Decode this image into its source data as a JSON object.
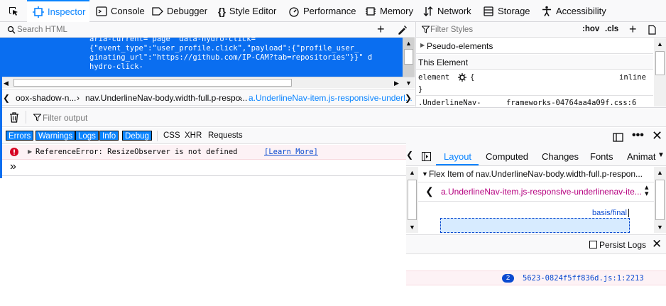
{
  "toolbar": {
    "tabs": [
      {
        "label": "Inspector",
        "icon": "inspector-icon"
      },
      {
        "label": "Console",
        "icon": "console-icon"
      },
      {
        "label": "Debugger",
        "icon": "debugger-icon"
      },
      {
        "label": "Style Editor",
        "icon": "style-editor-icon"
      },
      {
        "label": "Performance",
        "icon": "performance-icon"
      },
      {
        "label": "Memory",
        "icon": "memory-icon"
      },
      {
        "label": "Network",
        "icon": "network-icon"
      },
      {
        "label": "Storage",
        "icon": "storage-icon"
      },
      {
        "label": "Accessibility",
        "icon": "accessibility-icon"
      }
    ],
    "active_tab": "Inspector"
  },
  "inspector": {
    "search_placeholder": "Search HTML",
    "markup_lines": [
      "aria-current=\"page\" data-hydro-click=",
      "{\"event_type\":\"user_profile.click\",\"payload\":{\"profile_user_",
      "ginating_url\":\"https://github.com/IP-CAM?tab=repositories\"}}\" d",
      "hydro-click-",
      "                                                                 "
    ],
    "breadcrumbs": [
      "oox-shadow-n...",
      "nav.UnderlineNav-body.width-full.p-respo...",
      "a.UnderlineNav-item.js-responsive-underl..."
    ]
  },
  "rules": {
    "filter_placeholder": "Filter Styles",
    "hov_label": ":hov",
    "cls_label": ".cls",
    "pseudo_elements": "Pseudo-elements",
    "this_element": "This Element",
    "element_selector": "element",
    "element_brace_open": "{",
    "element_brace_close": "}",
    "inline_label": "inline",
    "next_rule_selector": ".UnderlineNav-",
    "next_rule_source": "frameworks-04764aa4a09f.css:6"
  },
  "console": {
    "filter_output_placeholder": "Filter output",
    "filters_active": [
      "Errors",
      "Warnings",
      "Logs",
      "Info",
      "Debug"
    ],
    "filters_plain": [
      "CSS",
      "XHR",
      "Requests"
    ],
    "error_message": "ReferenceError: ResizeObserver is not defined",
    "learn_more": "[Learn More]",
    "prompt_symbol": "»",
    "persist_logs": "Persist Logs",
    "message_count": "2",
    "message_source": "5623-0824f5ff836d.js:1:2213"
  },
  "layout": {
    "tabs": [
      "Layout",
      "Computed",
      "Changes",
      "Fonts",
      "Animat"
    ],
    "active_tab": "Layout",
    "flex_item_header": "Flex Item of nav.UnderlineNav-body.width-full.p-respon...",
    "flex_item_selector": "a.UnderlineNav-item.js-responsive-underlinenav-ite...",
    "basis_label": "basis/final"
  },
  "colors": {
    "accent": "#0a84ff",
    "selection": "#0a6ef0",
    "error_bg": "#fdf2f5",
    "error_icon": "#d70022"
  }
}
